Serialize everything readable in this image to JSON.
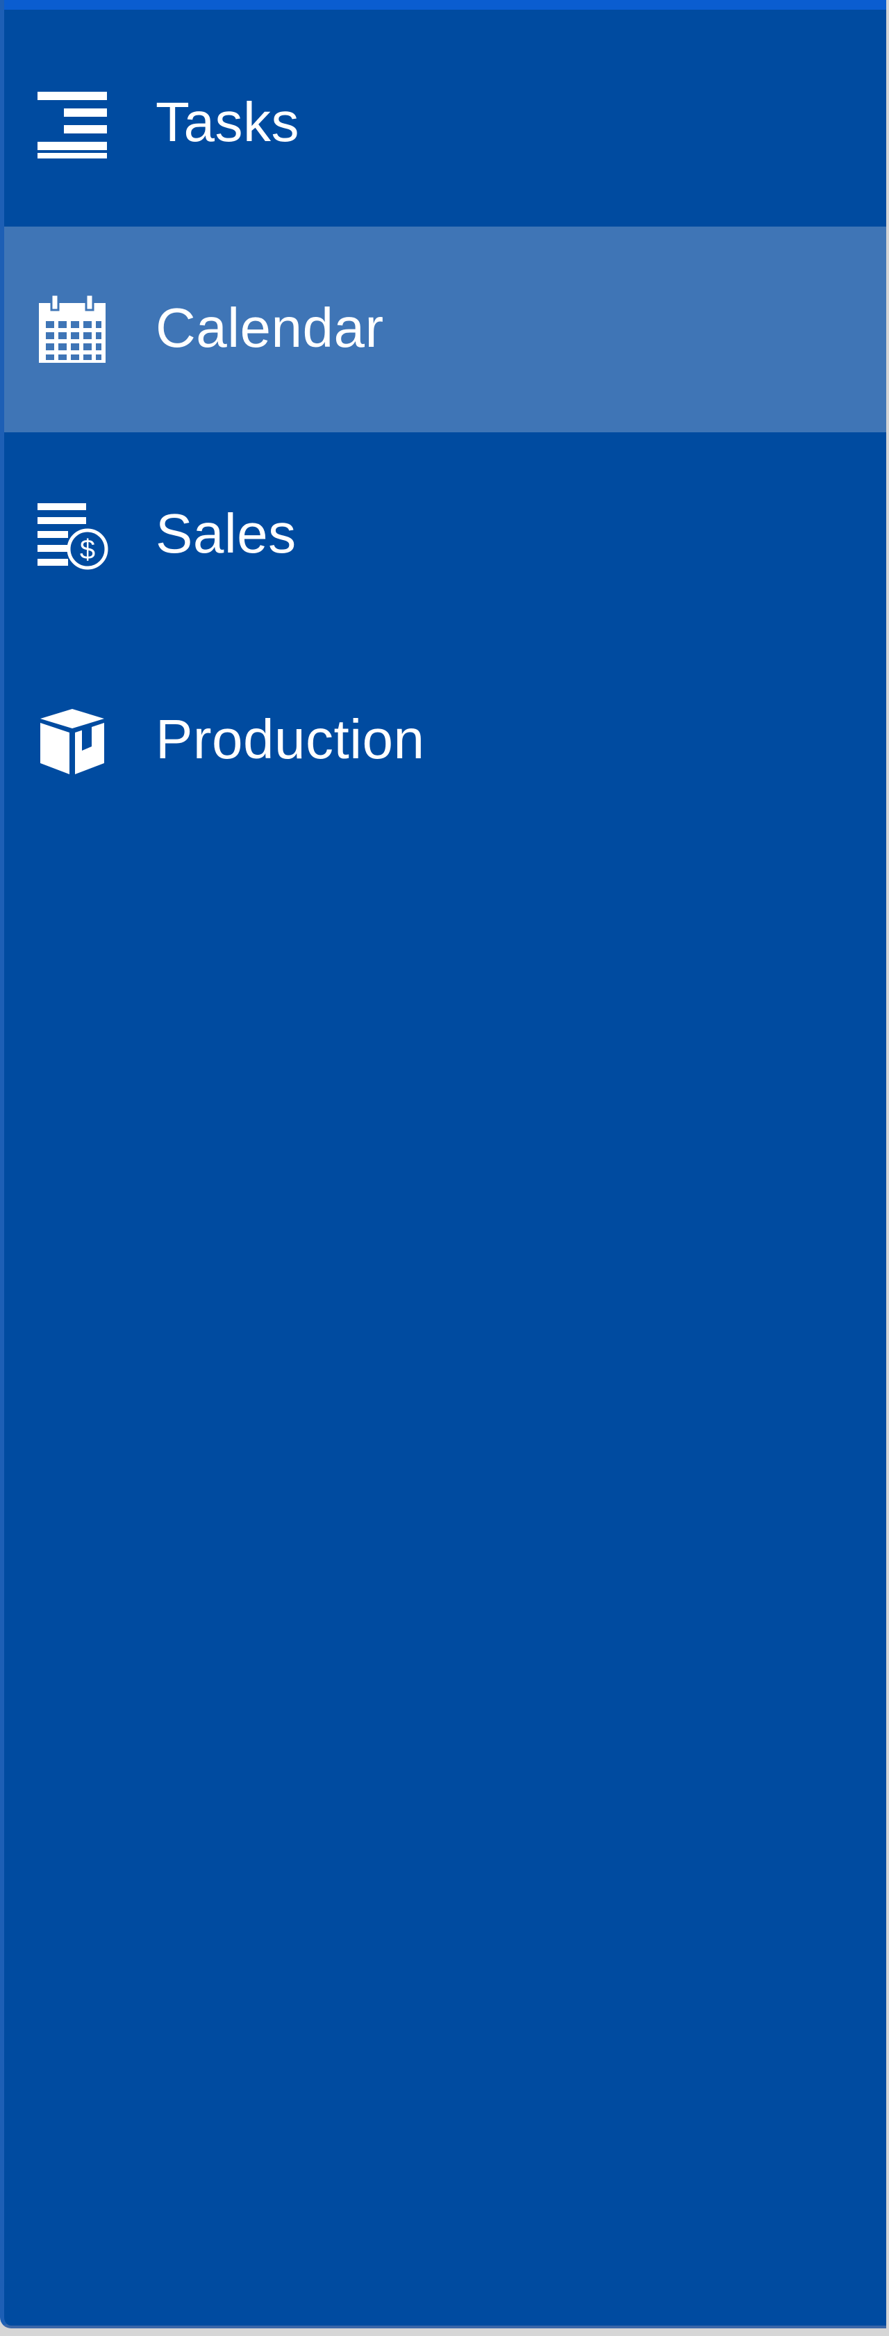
{
  "sidebar": {
    "items": [
      {
        "label": "Tasks",
        "icon": "tasks-list-icon",
        "active": false
      },
      {
        "label": "Calendar",
        "icon": "calendar-icon",
        "active": true
      },
      {
        "label": "Sales",
        "icon": "sales-list-dollar-icon",
        "active": false
      },
      {
        "label": "Production",
        "icon": "package-box-icon",
        "active": false
      }
    ]
  },
  "colors": {
    "sidebar_bg": "#004ba0",
    "active_bg": "#3f75b6",
    "top_accent": "#0a5dd0",
    "text": "#ffffff"
  }
}
